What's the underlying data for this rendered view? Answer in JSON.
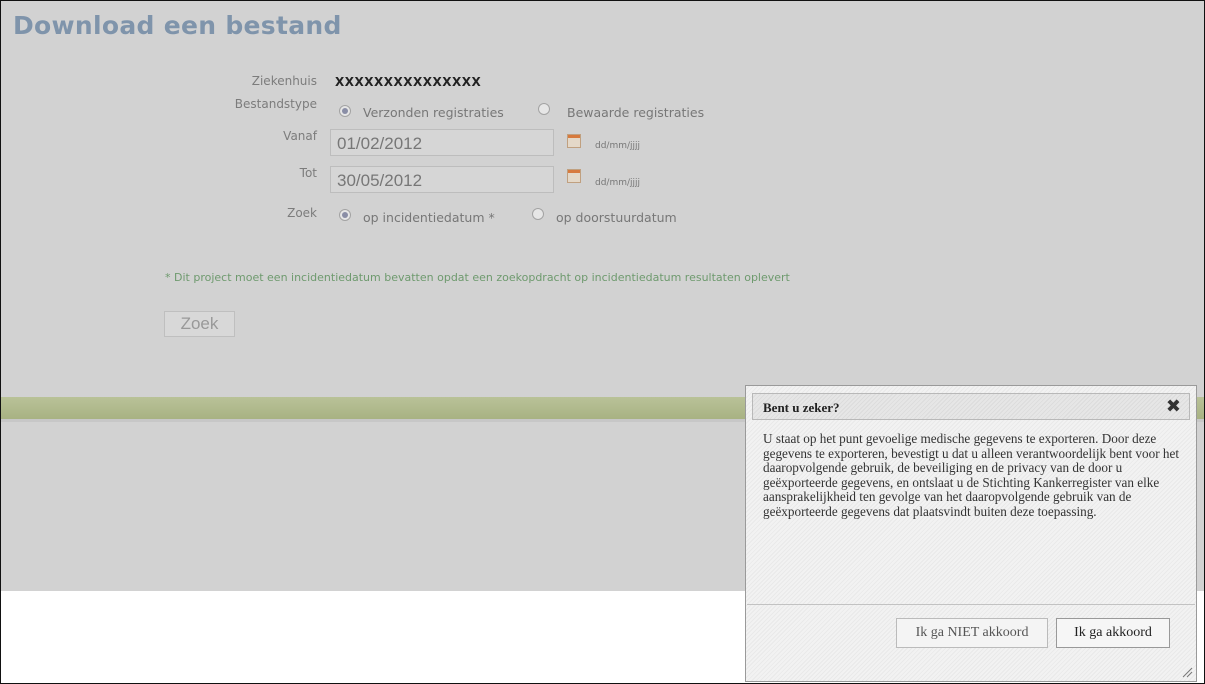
{
  "page": {
    "title": "Download een bestand"
  },
  "form": {
    "ziekenhuis": {
      "label": "Ziekenhuis",
      "value": "XXXXXXXXXXXXXXX"
    },
    "bestandstype": {
      "label": "Bestandstype",
      "options": [
        "Verzonden registraties",
        "Bewaarde registraties"
      ],
      "selected": "Verzonden registraties"
    },
    "vanaf": {
      "label": "Vanaf",
      "value": "01/02/2012",
      "format": "dd/mm/jjjj"
    },
    "tot": {
      "label": "Tot",
      "value": "30/05/2012",
      "format": "dd/mm/jjjj"
    },
    "zoek": {
      "label": "Zoek",
      "options": [
        "op incidentiedatum *",
        "op doorstuurdatum"
      ],
      "selected": "op incidentiedatum *"
    },
    "note": "* Dit project moet een incidentiedatum bevatten opdat een zoekopdracht op incidentiedatum resultaten oplevert",
    "search_button": "Zoek"
  },
  "dialog": {
    "title": "Bent u zeker?",
    "body": "U staat op het punt gevoelige medische gegevens te exporteren. Door deze gegevens te exporteren, bevestigt u dat u alleen verantwoordelijk bent voor het daaropvolgende gebruik, de beveiliging en de privacy van de door u geëxporteerde gegevens, en ontslaat u de Stichting Kankerregister van elke aansprakelijkheid ten gevolge van het daaropvolgende gebruik van de geëxporteerde gegevens dat plaatsvindt buiten deze toepassing.",
    "buttons": {
      "decline": "Ik ga NIET akkoord",
      "accept": "Ik ga akkoord"
    },
    "close_icon": "close-icon"
  }
}
